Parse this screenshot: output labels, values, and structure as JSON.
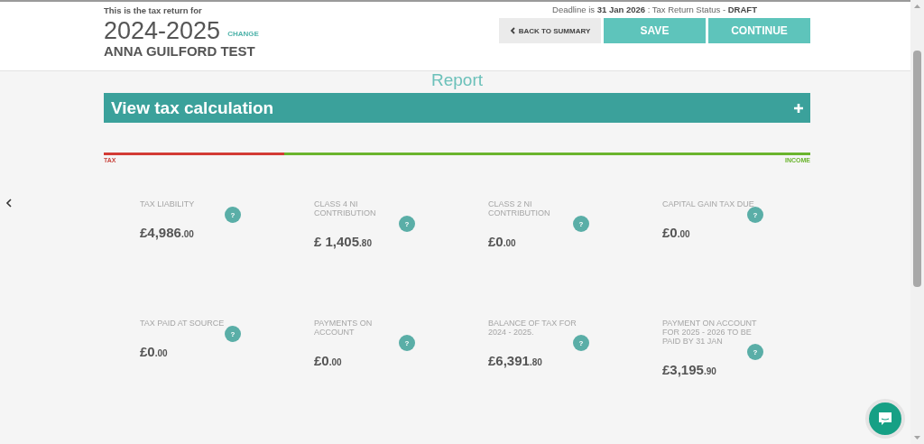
{
  "header": {
    "intro": "This is the tax return for",
    "year": "2024-2025",
    "change_link": "CHANGE",
    "name": "ANNA GUILFORD TEST",
    "deadline": "Deadline is **31 Jan 2026** : Tax Return Status - **DRAFT**",
    "buttons": [
      {
        "label": "BACK TO SUMMARY",
        "kind": "secondary"
      },
      {
        "label": "SAVE",
        "kind": "primary"
      },
      {
        "label": "CONTINUE",
        "kind": "primary"
      }
    ]
  },
  "report_title": "Report",
  "accordion": {
    "title": "View tax calculation",
    "expanded": false
  },
  "tax_bar": {
    "level": 0.255,
    "left_label": "TAX",
    "right_label": "INCOME"
  },
  "cards": [
    {
      "label": "TAX LIABILITY",
      "amount": "£4,986",
      "cents": ".00"
    },
    {
      "label": "CLASS 4 NI CONTRIBUTION",
      "amount": "£ 1,405",
      "cents": ".80"
    },
    {
      "label": "CLASS 2 NI CONTRIBUTION",
      "amount": "£0",
      "cents": ".00"
    },
    {
      "label": "CAPITAL GAIN TAX DUE",
      "amount": "£0",
      "cents": ".00"
    },
    {
      "label": "TAX PAID AT SOURCE",
      "amount": "£0",
      "cents": ".00"
    },
    {
      "label": "PAYMENTS ON ACCOUNT",
      "amount": "£0",
      "cents": ".00"
    },
    {
      "label": "BALANCE OF TAX FOR 2024 - 2025.",
      "amount": "£6,391",
      "cents": ".80"
    },
    {
      "label": "PAYMENT ON ACCOUNT FOR 2025 - 2026 TO BE PAID BY 31 JAN",
      "amount": "£3,195",
      "cents": ".90"
    }
  ],
  "help_icon": "?"
}
